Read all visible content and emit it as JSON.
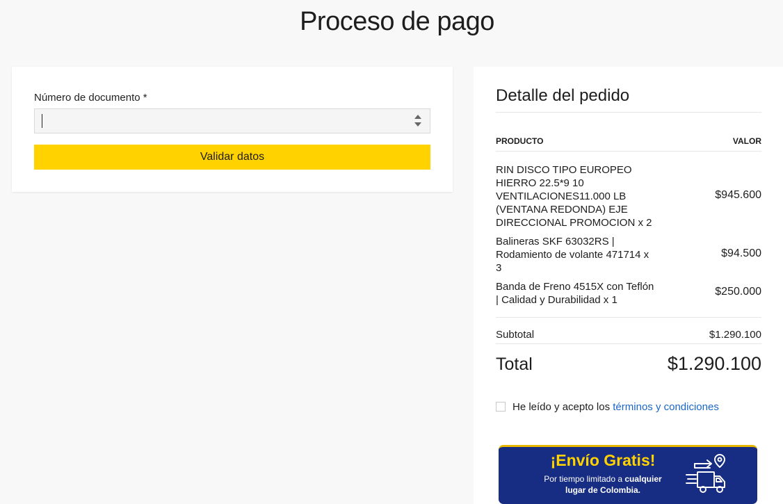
{
  "page": {
    "title": "Proceso de pago"
  },
  "document_form": {
    "label": "Número de documento *",
    "value": "",
    "validate_button": "Validar datos"
  },
  "order": {
    "title": "Detalle del pedido",
    "col_product": "PRODUCTO",
    "col_value": "VALOR",
    "items": [
      {
        "name": "RIN DISCO TIPO EUROPEO HIERRO 22.5*9 10 VENTILACIONES11.000 LB (VENTANA REDONDA) EJE DIRECCIONAL PROMOCION x 2",
        "price": "$945.600"
      },
      {
        "name": "Balineras SKF 63032RS | Rodamiento de volante 471714 x 3",
        "price": "$94.500"
      },
      {
        "name": "Banda de Freno 4515X con Teflón | Calidad y Durabilidad x 1",
        "price": "$250.000"
      }
    ],
    "subtotal_label": "Subtotal",
    "subtotal_value": "$1.290.100",
    "total_label": "Total",
    "total_value": "$1.290.100"
  },
  "terms": {
    "text": "He leído y acepto los ",
    "link": "términos y condiciones",
    "checked": false
  },
  "banner": {
    "title": "¡Envío Gratis!",
    "line1_plain": "Por tiempo limitado a ",
    "line1_bold": "cualquier",
    "line2_bold": "lugar de Colombia.",
    "icon": "delivery-truck-icon"
  },
  "colors": {
    "accent": "#ffd200",
    "banner_bg": "#172c83",
    "link": "#1a66c8",
    "page_bg": "#f8f8f8"
  }
}
